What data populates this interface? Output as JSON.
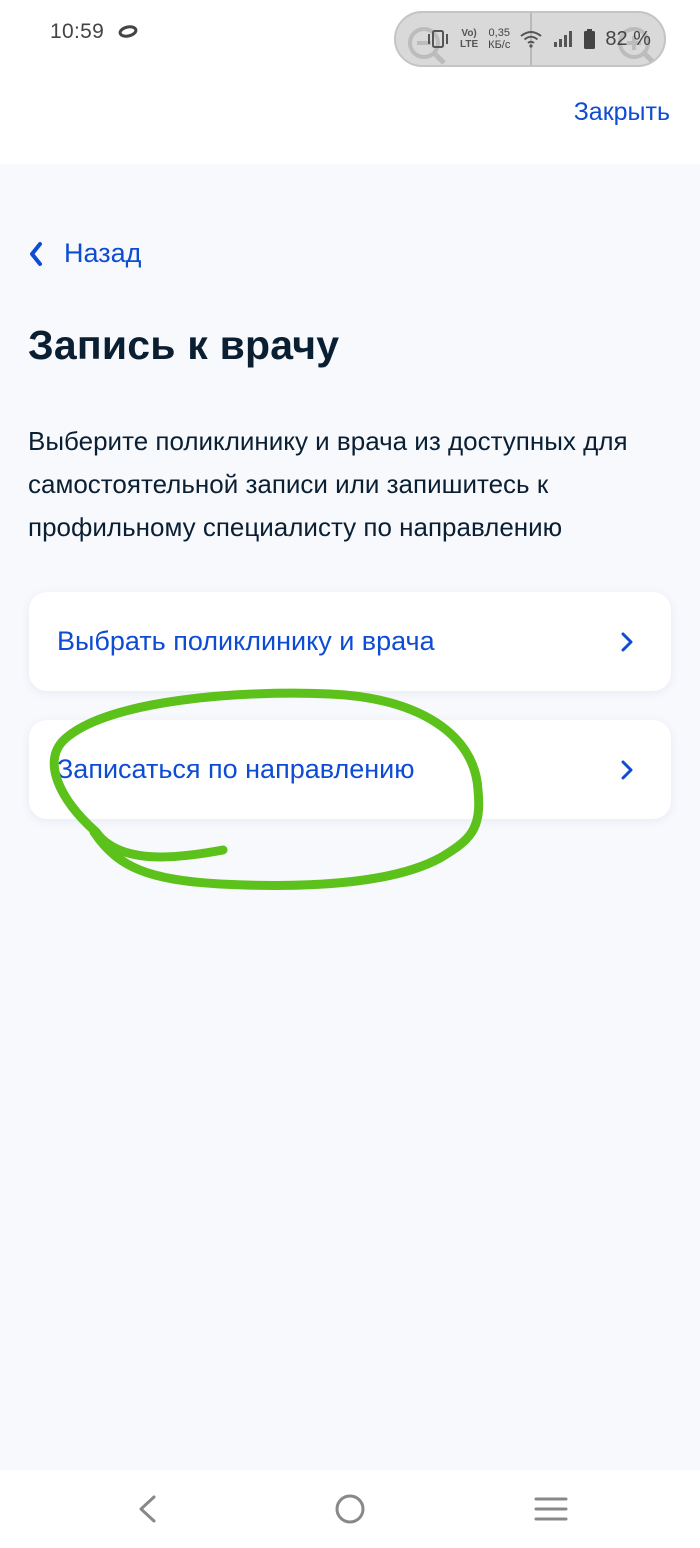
{
  "status_bar": {
    "time": "10:59",
    "volte_line1": "Vo)",
    "volte_line2": "LTE",
    "speed_value": "0,35",
    "speed_unit": "КБ/с",
    "battery": "82 %",
    "icons": [
      "ring-icon",
      "vibrate-icon",
      "wifi-icon",
      "signal-icon",
      "battery-icon",
      "zoom-out-icon",
      "zoom-in-icon"
    ]
  },
  "header": {
    "close_label": "Закрыть"
  },
  "back": {
    "label": "Назад",
    "icon": "chevron-left-icon"
  },
  "page": {
    "title": "Запись к врачу",
    "description": "Выберите поликлинику и врача из доступных для самостоятельной записи или запишитесь к профильному специалисту по направлению"
  },
  "options": [
    {
      "label": "Выбрать поликлинику и врача",
      "icon": "chevron-right-icon"
    },
    {
      "label": "Записаться по направлению",
      "icon": "chevron-right-icon"
    }
  ],
  "annotation": {
    "color": "#5cc11a"
  },
  "colors": {
    "accent": "#0d4cd3",
    "text": "#0b1f33",
    "background": "#f8f9fd",
    "card": "#ffffff"
  },
  "nav_bar": {
    "icons": [
      "nav-back-icon",
      "nav-home-icon",
      "nav-menu-icon"
    ]
  }
}
